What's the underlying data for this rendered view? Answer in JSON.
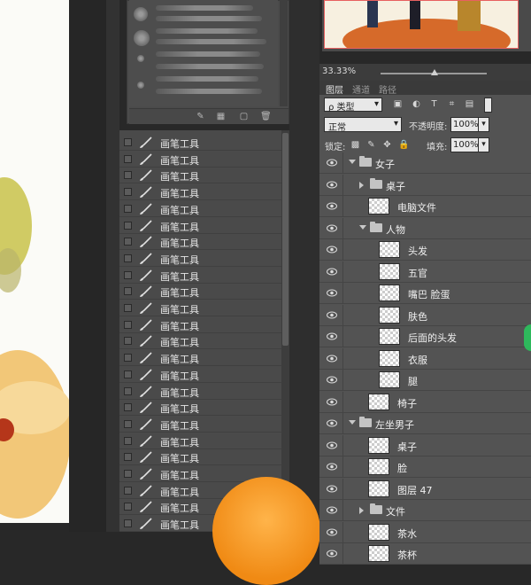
{
  "history": {
    "items": [
      "画笔工具",
      "画笔工具",
      "画笔工具",
      "画笔工具",
      "画笔工具",
      "画笔工具",
      "画笔工具",
      "画笔工具",
      "画笔工具",
      "画笔工具",
      "画笔工具",
      "画笔工具",
      "画笔工具",
      "画笔工具",
      "画笔工具",
      "画笔工具",
      "画笔工具",
      "画笔工具",
      "画笔工具",
      "画笔工具",
      "画笔工具",
      "画笔工具",
      "画笔工具",
      "画笔工具"
    ],
    "item_icon": "brush-icon"
  },
  "navigator": {
    "zoom": "33.33%"
  },
  "tabs": [
    "图层",
    "通道",
    "路径"
  ],
  "layer_controls": {
    "filter_label": "ρ 类型",
    "blend_mode": "正常",
    "opacity_label": "不透明度:",
    "opacity_value": "100%",
    "lock_label": "锁定:",
    "fill_label": "填充:",
    "fill_value": "100%"
  },
  "layers": [
    {
      "name": "女子",
      "type": "group",
      "expanded": true,
      "level": 0
    },
    {
      "name": "桌子",
      "type": "group",
      "expanded": false,
      "level": 1
    },
    {
      "name": "电脑文件",
      "type": "layer",
      "level": 1
    },
    {
      "name": "人物",
      "type": "group",
      "expanded": true,
      "level": 1
    },
    {
      "name": "头发",
      "type": "layer",
      "level": 2
    },
    {
      "name": "五官",
      "type": "layer",
      "level": 2
    },
    {
      "name": "嘴巴 脸蛋",
      "type": "layer",
      "level": 2
    },
    {
      "name": "肤色",
      "type": "layer",
      "level": 2
    },
    {
      "name": "后面的头发",
      "type": "layer",
      "level": 2
    },
    {
      "name": "衣服",
      "type": "layer",
      "level": 2
    },
    {
      "name": "腿",
      "type": "layer",
      "level": 2
    },
    {
      "name": "椅子",
      "type": "layer",
      "level": 1
    },
    {
      "name": "左坐男子",
      "type": "group",
      "expanded": true,
      "level": 0
    },
    {
      "name": "桌子",
      "type": "layer",
      "level": 1
    },
    {
      "name": "脸",
      "type": "layer",
      "level": 1
    },
    {
      "name": "图层 47",
      "type": "layer",
      "level": 1
    },
    {
      "name": "文件",
      "type": "group",
      "expanded": false,
      "level": 1
    },
    {
      "name": "茶水",
      "type": "layer",
      "level": 1
    },
    {
      "name": "茶杯",
      "type": "layer",
      "level": 1
    }
  ],
  "colors": {
    "panel": "#535353",
    "history_bg": "#4a4a4a",
    "accent_orange": "#f08a14",
    "canvas_accent": "#e86060"
  }
}
